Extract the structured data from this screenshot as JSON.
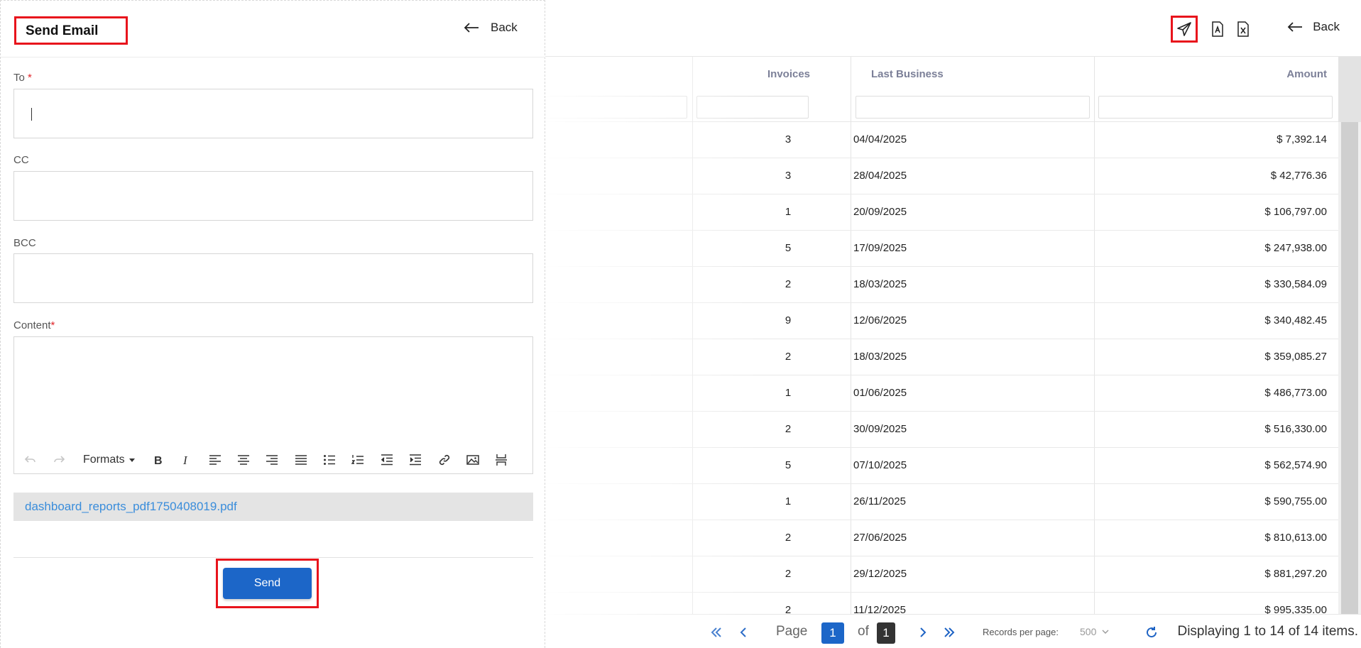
{
  "email_panel": {
    "title": "Send Email",
    "back_label": "Back",
    "to_label": "To",
    "to_value": "",
    "cc_label": "CC",
    "cc_value": "",
    "bcc_label": "BCC",
    "bcc_value": "",
    "content_label": "Content",
    "required_mark": "*",
    "formats_label": "Formats",
    "attachment": "dashboard_reports_pdf1750408019.pdf",
    "send_label": "Send"
  },
  "report": {
    "back_label": "Back",
    "columns": [
      "Invoices",
      "Last Business",
      "Amount"
    ],
    "rows": [
      {
        "invoices": "3",
        "last_business": "04/04/2025",
        "amount": "$ 7,392.14"
      },
      {
        "invoices": "3",
        "last_business": "28/04/2025",
        "amount": "$ 42,776.36"
      },
      {
        "invoices": "1",
        "last_business": "20/09/2025",
        "amount": "$ 106,797.00"
      },
      {
        "invoices": "5",
        "last_business": "17/09/2025",
        "amount": "$ 247,938.00"
      },
      {
        "invoices": "2",
        "last_business": "18/03/2025",
        "amount": "$ 330,584.09"
      },
      {
        "invoices": "9",
        "last_business": "12/06/2025",
        "amount": "$ 340,482.45"
      },
      {
        "invoices": "2",
        "last_business": "18/03/2025",
        "amount": "$ 359,085.27"
      },
      {
        "invoices": "1",
        "last_business": "01/06/2025",
        "amount": "$ 486,773.00"
      },
      {
        "invoices": "2",
        "last_business": "30/09/2025",
        "amount": "$ 516,330.00"
      },
      {
        "invoices": "5",
        "last_business": "07/10/2025",
        "amount": "$ 562,574.90"
      },
      {
        "invoices": "1",
        "last_business": "26/11/2025",
        "amount": "$ 590,755.00"
      },
      {
        "invoices": "2",
        "last_business": "27/06/2025",
        "amount": "$ 810,613.00"
      },
      {
        "invoices": "2",
        "last_business": "29/12/2025",
        "amount": "$ 881,297.20"
      },
      {
        "invoices": "2",
        "last_business": "11/12/2025",
        "amount": "$ 995,335.00"
      }
    ]
  },
  "pager": {
    "page_label": "Page",
    "current_page": "1",
    "of_label": "of",
    "total_pages": "1",
    "records_label": "Records per page:",
    "records_value": "500",
    "display_text": "Displaying 1 to 14 of 14 items."
  },
  "colors": {
    "accent": "#1c66c8",
    "highlight": "#e8141c",
    "link": "#3a8ddb",
    "page_box_current": "#1c66c8",
    "page_box_total": "#333333"
  },
  "icons": [
    "send-icon",
    "pdf-icon",
    "excel-icon",
    "back-arrow-icon",
    "undo-icon",
    "redo-icon",
    "bold-icon",
    "italic-icon",
    "align-left-icon",
    "align-center-icon",
    "align-right-icon",
    "align-justify-icon",
    "bullet-list-icon",
    "numbered-list-icon",
    "outdent-icon",
    "indent-icon",
    "link-icon",
    "image-icon",
    "page-break-icon",
    "first-page-icon",
    "prev-page-icon",
    "next-page-icon",
    "last-page-icon",
    "refresh-icon"
  ]
}
